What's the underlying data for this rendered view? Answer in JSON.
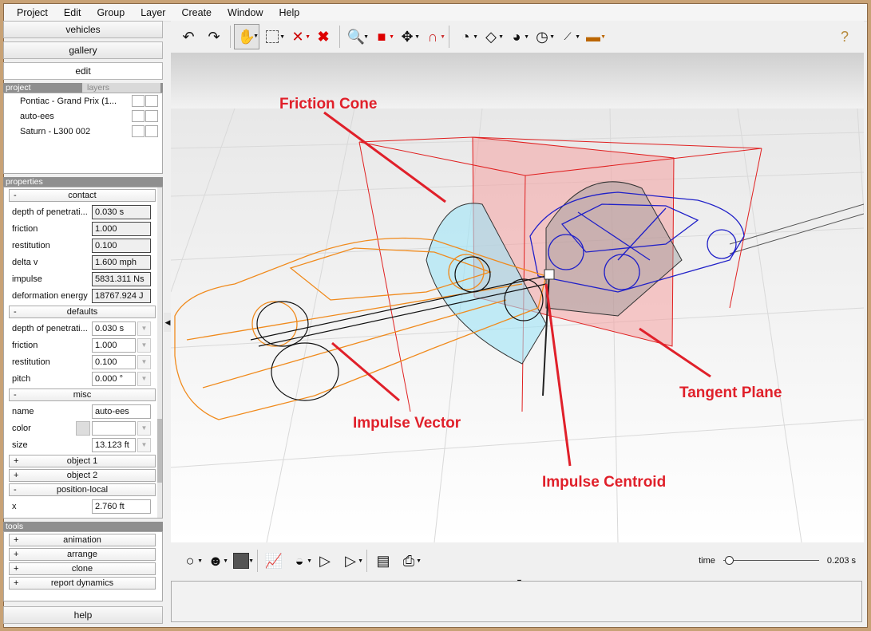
{
  "menu": [
    "Project",
    "Edit",
    "Group",
    "Layer",
    "Create",
    "Window",
    "Help"
  ],
  "nav": {
    "vehicles": "vehicles",
    "gallery": "gallery",
    "edit": "edit",
    "help": "help"
  },
  "panel_tabs": {
    "project": "project",
    "layers": "layers",
    "properties": "properties",
    "tools": "tools"
  },
  "project_items": [
    "Pontiac - Grand Prix (1...",
    "auto-ees",
    "Saturn - L300 002"
  ],
  "contact": {
    "header": "contact",
    "sign": "-",
    "rows": [
      {
        "label": "depth of penetrati...",
        "value": "0.030 s"
      },
      {
        "label": "friction",
        "value": "1.000"
      },
      {
        "label": "restitution",
        "value": "0.100"
      },
      {
        "label": "delta v",
        "value": "1.600 mph"
      },
      {
        "label": "impulse",
        "value": "5831.311 Ns"
      },
      {
        "label": "deformation energy",
        "value": "18767.924 J"
      }
    ]
  },
  "defaults": {
    "header": "defaults",
    "sign": "-",
    "rows": [
      {
        "label": "depth of penetrati...",
        "value": "0.030 s"
      },
      {
        "label": "friction",
        "value": "1.000"
      },
      {
        "label": "restitution",
        "value": "0.100"
      },
      {
        "label": "pitch",
        "value": "0.000 °"
      }
    ]
  },
  "misc": {
    "header": "misc",
    "sign": "-",
    "name_label": "name",
    "name_value": "auto-ees",
    "color_label": "color",
    "size_label": "size",
    "size_value": "13.123 ft"
  },
  "object1": {
    "header": "object 1",
    "sign": "+"
  },
  "object2": {
    "header": "object 2",
    "sign": "+"
  },
  "position_local": {
    "header": "position-local",
    "sign": "-",
    "x_label": "x",
    "x_value": "2.760 ft"
  },
  "tools": [
    {
      "sign": "+",
      "label": "animation"
    },
    {
      "sign": "+",
      "label": "arrange"
    },
    {
      "sign": "+",
      "label": "clone"
    },
    {
      "sign": "+",
      "label": "report dynamics"
    }
  ],
  "annotations": {
    "friction_cone": "Friction Cone",
    "impulse_vector": "Impulse Vector",
    "tangent_plane": "Tangent Plane",
    "impulse_centroid": "Impulse Centroid"
  },
  "time": {
    "label": "time",
    "value": "0.203 s",
    "slider_fraction": 0.02
  },
  "colors": {
    "annotation": "#e0202a",
    "car1": "#f08a1c",
    "car2": "#2020c8",
    "plane": "#f4a0a0",
    "cone": "#9fe4f6"
  }
}
